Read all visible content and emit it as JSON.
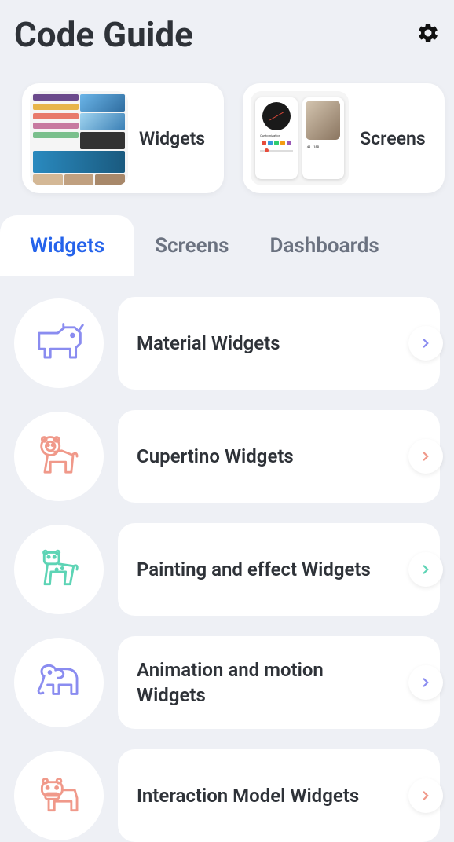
{
  "header": {
    "title": "Code Guide"
  },
  "carousel": [
    {
      "label": "Widgets"
    },
    {
      "label": "Screens"
    }
  ],
  "tabs": [
    {
      "label": "Widgets",
      "active": true
    },
    {
      "label": "Screens",
      "active": false
    },
    {
      "label": "Dashboards",
      "active": false
    }
  ],
  "items": [
    {
      "label": "Material Widgets",
      "icon": "rhino",
      "color": "#8a8cf0"
    },
    {
      "label": "Cupertino Widgets",
      "icon": "lion",
      "color": "#f0998a"
    },
    {
      "label": "Painting and effect Widgets",
      "icon": "leopard",
      "color": "#5dd4b5"
    },
    {
      "label": "Animation and motion Widgets",
      "icon": "elephant",
      "color": "#8a8cf0"
    },
    {
      "label": "Interaction Model Widgets",
      "icon": "hippo",
      "color": "#f0998a"
    }
  ],
  "chevron_colors": [
    "#8a8cf0",
    "#f0998a",
    "#5dd4b5",
    "#8a8cf0",
    "#f0998a"
  ]
}
